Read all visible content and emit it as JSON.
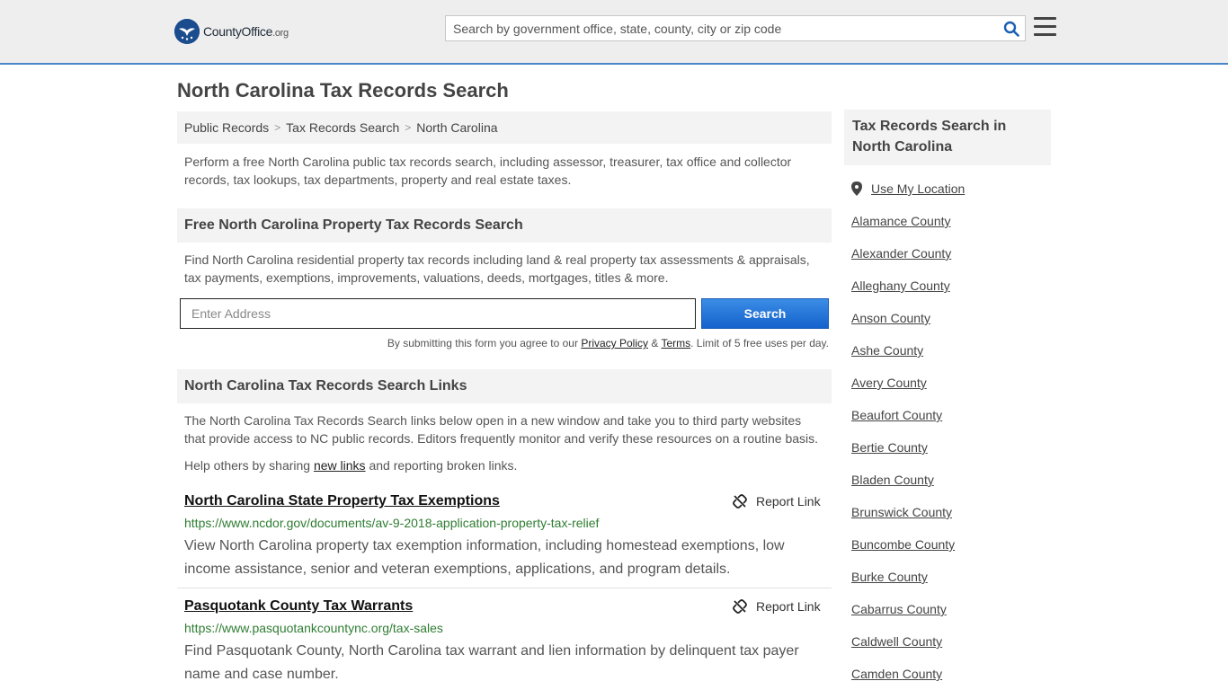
{
  "header": {
    "logo": {
      "brand": "CountyOffice",
      "tld": ".org"
    },
    "search_placeholder": "Search by government office, state, county, city or zip code"
  },
  "page_title": "North Carolina Tax Records Search",
  "breadcrumb": [
    "Public Records",
    "Tax Records Search",
    "North Carolina"
  ],
  "intro": "Perform a free North Carolina public tax records search, including assessor, treasurer, tax office and collector records, tax lookups, tax departments, property and real estate taxes.",
  "property_search": {
    "heading": "Free North Carolina Property Tax Records Search",
    "description": "Find North Carolina residential property tax records including land & real property tax assessments & appraisals, tax payments, exemptions, improvements, valuations, deeds, mortgages, titles & more.",
    "address_placeholder": "Enter Address",
    "search_label": "Search",
    "disclaimer_prefix": "By submitting this form you agree to our ",
    "privacy_label": "Privacy Policy",
    "amp": " & ",
    "terms_label": "Terms",
    "disclaimer_suffix": ". Limit of 5 free uses per day."
  },
  "links_section": {
    "heading": "North Carolina Tax Records Search Links",
    "description": "The North Carolina Tax Records Search links below open in a new window and take you to third party websites that provide access to NC public records. Editors frequently monitor and verify these resources on a routine basis.",
    "help_prefix": "Help others by sharing ",
    "help_link": "new links",
    "help_suffix": " and reporting broken links."
  },
  "links": [
    {
      "title": "North Carolina State Property Tax Exemptions",
      "url": "https://www.ncdor.gov/documents/av-9-2018-application-property-tax-relief",
      "description": "View North Carolina property tax exemption information, including homestead exemptions, low income assistance, senior and veteran exemptions, applications, and program details.",
      "report_label": "Report Link"
    },
    {
      "title": "Pasquotank County Tax Warrants",
      "url": "https://www.pasquotankcountync.org/tax-sales",
      "description": "Find Pasquotank County, North Carolina tax warrant and lien information by delinquent tax payer name and case number.",
      "report_label": "Report Link"
    }
  ],
  "sidebar": {
    "heading": "Tax Records Search in North Carolina",
    "use_location": "Use My Location",
    "counties": [
      "Alamance County",
      "Alexander County",
      "Alleghany County",
      "Anson County",
      "Ashe County",
      "Avery County",
      "Beaufort County",
      "Bertie County",
      "Bladen County",
      "Brunswick County",
      "Buncombe County",
      "Burke County",
      "Cabarrus County",
      "Caldwell County",
      "Camden County"
    ]
  },
  "colors": {
    "accent": "#4a86c7",
    "button": "#1a6fd8",
    "url_green": "#2f7d32"
  }
}
